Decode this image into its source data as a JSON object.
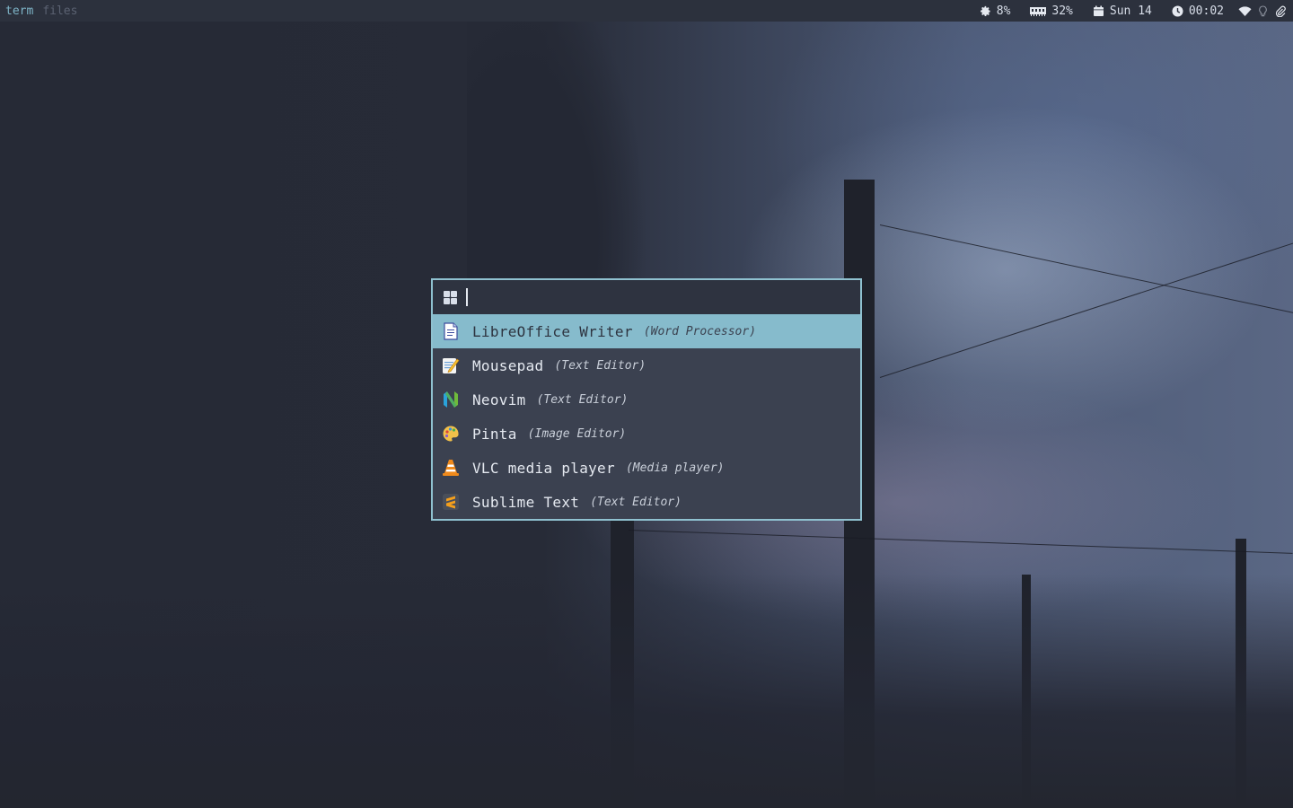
{
  "topbar": {
    "workspaces": [
      {
        "label": "term",
        "active": true
      },
      {
        "label": "files",
        "active": false
      }
    ],
    "status": {
      "cpu": {
        "icon": "gear-icon",
        "value": "8%"
      },
      "memory": {
        "icon": "memory-icon",
        "value": "32%"
      },
      "date": {
        "icon": "calendar-icon",
        "value": "Sun 14"
      },
      "time": {
        "icon": "clock-icon",
        "value": "00:02"
      },
      "tray_icons": [
        "wifi-icon",
        "lightbulb-icon",
        "paperclip-icon"
      ]
    }
  },
  "launcher": {
    "mode_icon": "grid-icon",
    "query": "",
    "selected_index": 0,
    "items": [
      {
        "name": "LibreOffice Writer",
        "category": "(Word Processor)",
        "icon": "libreoffice-writer-icon"
      },
      {
        "name": "Mousepad",
        "category": "(Text Editor)",
        "icon": "mousepad-icon"
      },
      {
        "name": "Neovim",
        "category": "(Text Editor)",
        "icon": "neovim-icon"
      },
      {
        "name": "Pinta",
        "category": "(Image Editor)",
        "icon": "pinta-icon"
      },
      {
        "name": "VLC media player",
        "category": "(Media player)",
        "icon": "vlc-icon"
      },
      {
        "name": "Sublime Text",
        "category": "(Text Editor)",
        "icon": "sublime-text-icon"
      }
    ]
  },
  "colors": {
    "accent": "#86bbcc",
    "border": "#8fc1d0",
    "bar_bg": "#2c313d",
    "menu_bg": "#3b4150"
  }
}
